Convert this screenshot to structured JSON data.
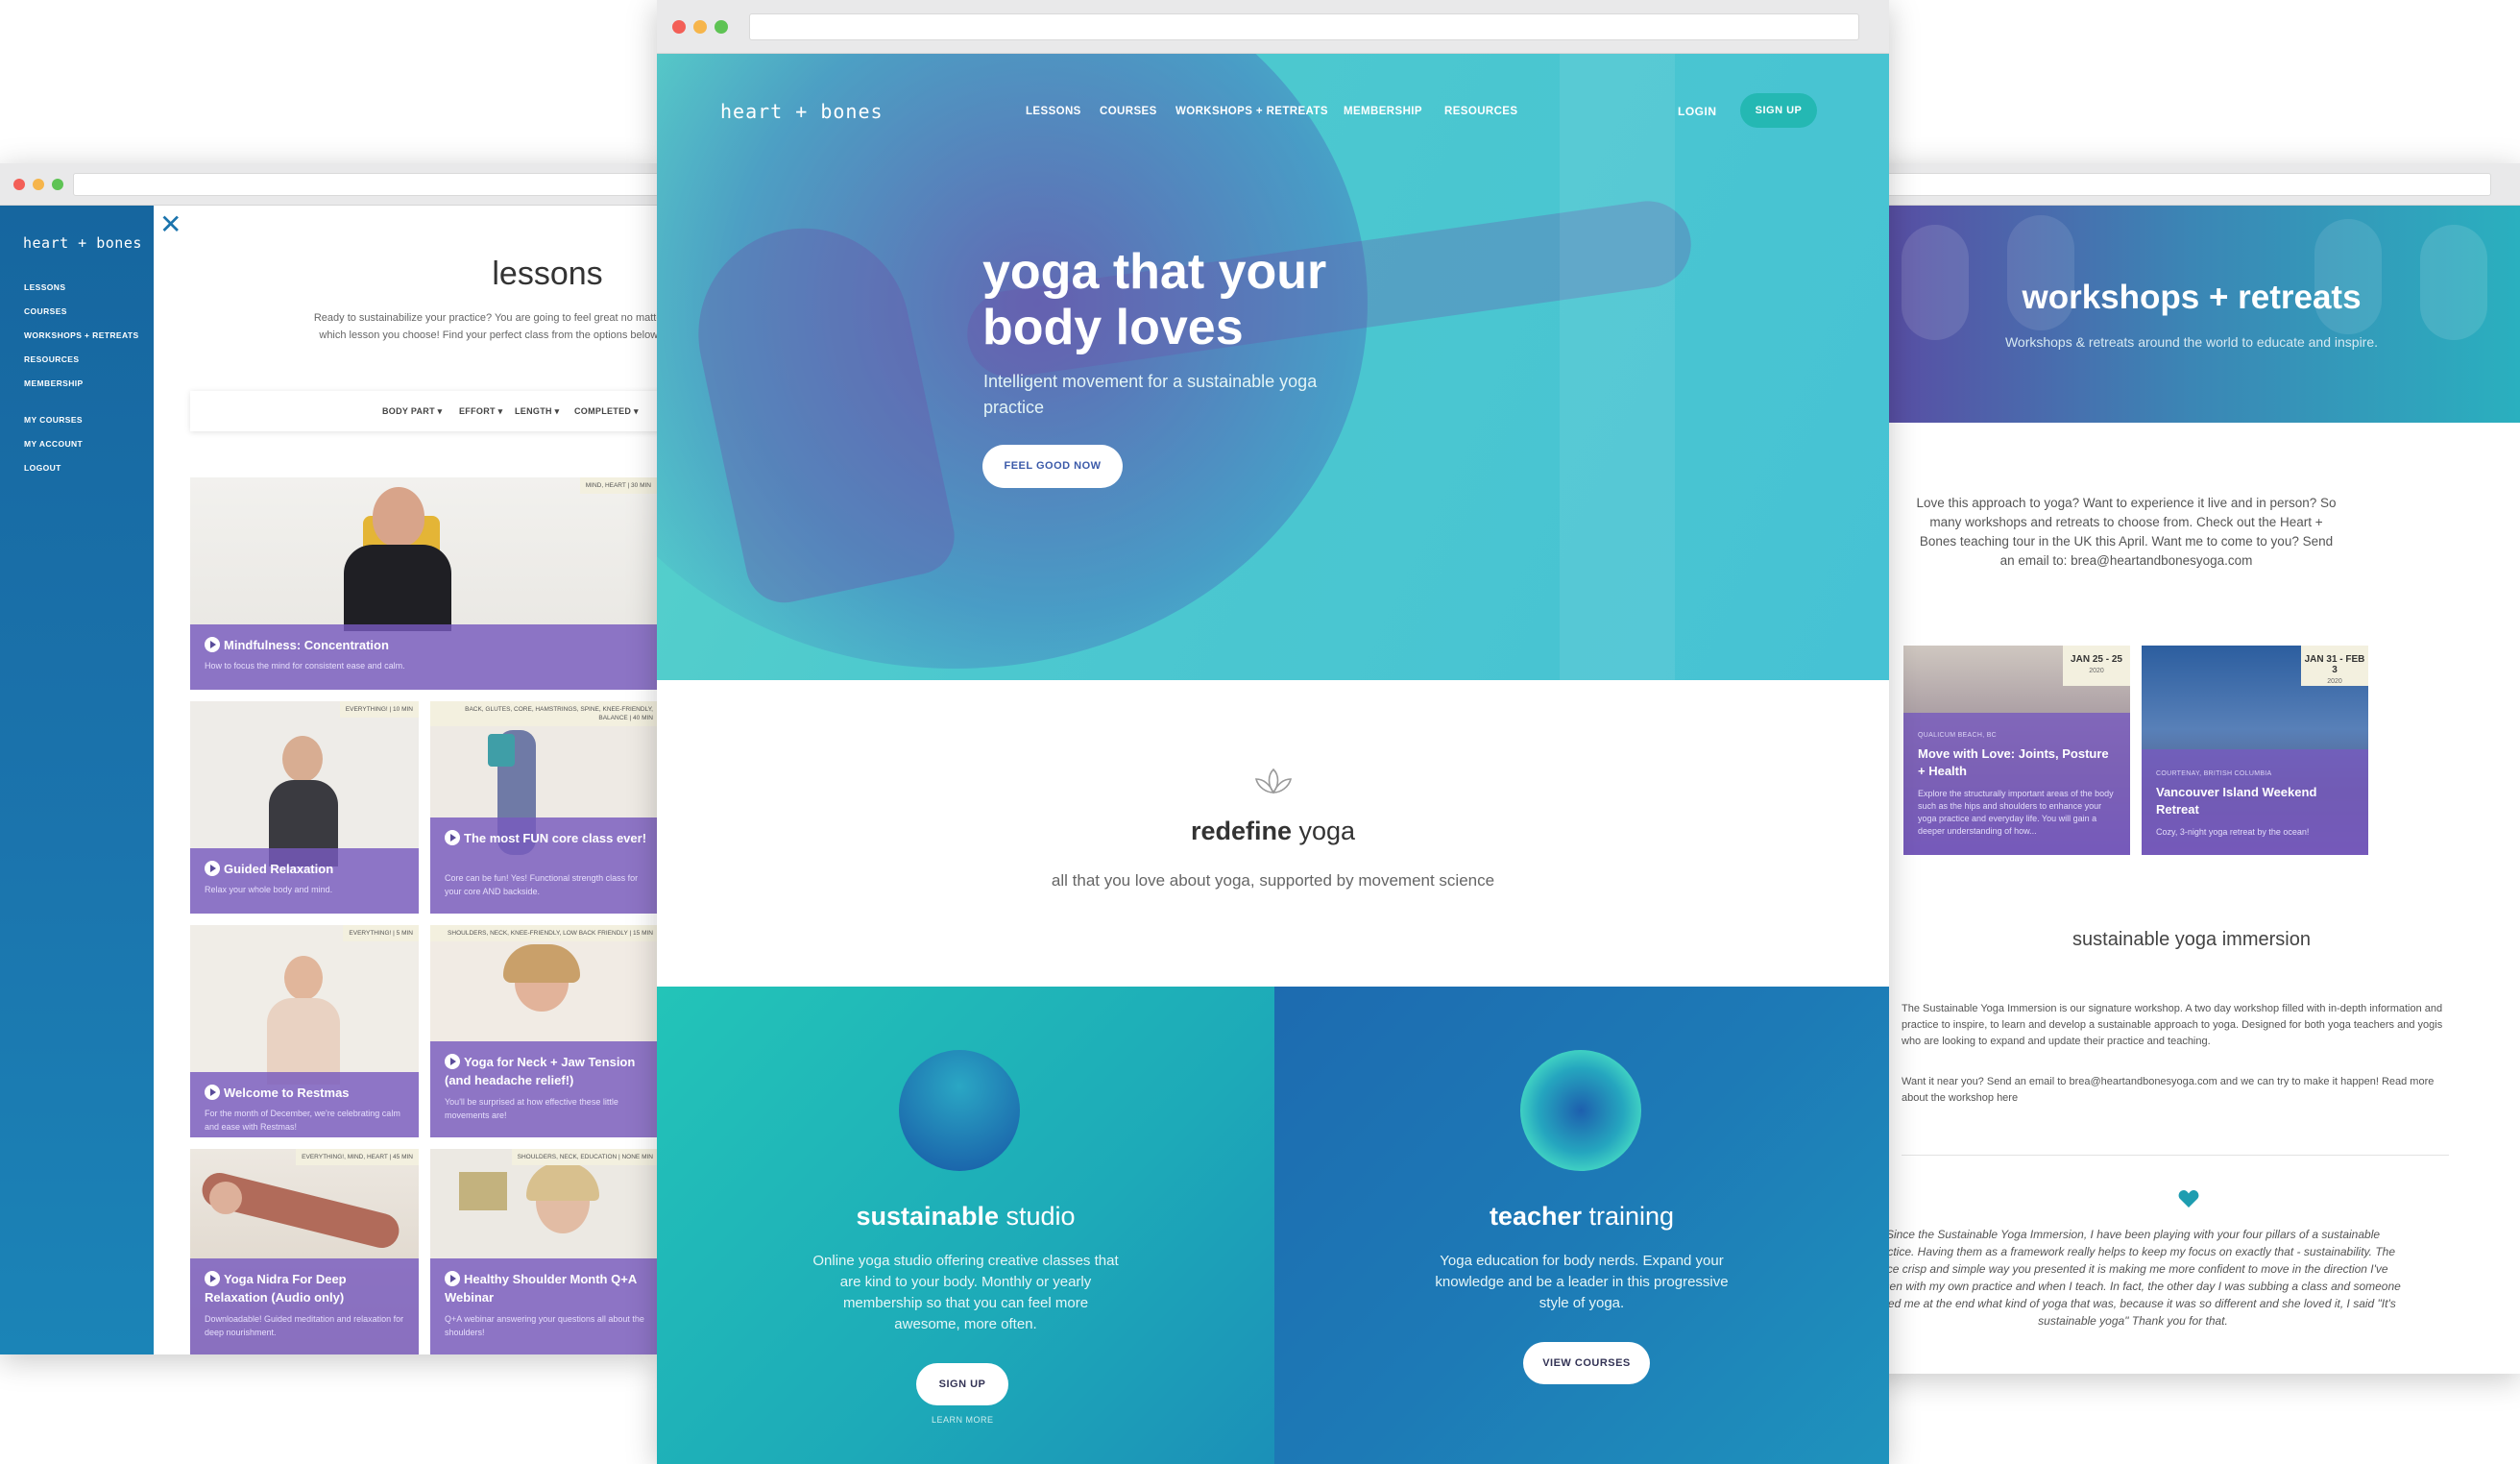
{
  "left_window": {
    "sidebar": {
      "logo": "heart + bones",
      "items": [
        "LESSONS",
        "COURSES",
        "WORKSHOPS + RETREATS",
        "RESOURCES",
        "MEMBERSHIP"
      ],
      "account_items": [
        "MY COURSES",
        "MY ACCOUNT",
        "LOGOUT"
      ]
    },
    "close_icon": "close-icon",
    "title": "lessons",
    "intro": "Ready to sustainabilize your practice? You are going to feel great no matter which lesson you choose! Find your perfect class from the options below.",
    "filters": [
      "BODY PART",
      "EFFORT",
      "LENGTH",
      "COMPLETED"
    ],
    "cards": [
      {
        "title": "Mindfulness: Concentration",
        "desc": "How to focus the mind for consistent ease and calm.",
        "tag": "MIND, HEART | 30 MIN"
      },
      {
        "title": "Guided Relaxation",
        "desc": "Relax your whole body and mind.",
        "tag": "EVERYTHING! | 10 MIN"
      },
      {
        "title": "The most FUN core class ever!",
        "desc": "Core can be fun! Yes! Functional strength class for your core AND backside.",
        "tag": "BACK, GLUTES, CORE, HAMSTRINGS, SPINE, KNEE-FRIENDLY, BALANCE | 40 MIN"
      },
      {
        "title": "Welcome to Restmas",
        "desc": "For the month of December, we're celebrating calm and ease with Restmas!",
        "tag": "EVERYTHING! | 5 MIN"
      },
      {
        "title": "Yoga for Neck + Jaw Tension (and headache relief!)",
        "desc": "You'll be surprised at how effective these little movements are!",
        "tag": "SHOULDERS, NECK, KNEE-FRIENDLY, LOW BACK FRIENDLY | 15 MIN"
      },
      {
        "title": "Yoga Nidra For Deep Relaxation (Audio only)",
        "desc": "Downloadable! Guided meditation and relaxation for deep nourishment.",
        "tag": "EVERYTHING!, MIND, HEART | 45 MIN"
      },
      {
        "title": "Healthy Shoulder Month Q+A Webinar",
        "desc": "Q+A webinar answering your questions all about the shoulders!",
        "tag": "SHOULDERS, NECK, EDUCATION | NONE MIN"
      }
    ]
  },
  "center_window": {
    "logo": "heart + bones",
    "nav": [
      "LESSONS",
      "COURSES",
      "WORKSHOPS + RETREATS",
      "MEMBERSHIP",
      "RESOURCES"
    ],
    "login": "LOGIN",
    "signup": "SIGN UP",
    "hero": {
      "title": "yoga that your body loves",
      "subtitle": "Intelligent movement for a sustainable yoga practice",
      "button": "FEEL GOOD NOW"
    },
    "redefine": {
      "strong": "redefine",
      "rest": " yoga",
      "subtitle": "all that you love about yoga, supported by movement science"
    },
    "panels": [
      {
        "strong": "sustainable",
        "rest": " studio",
        "desc": "Online yoga studio offering creative classes that are kind to your body. Monthly or yearly membership so that you can feel more awesome, more often.",
        "button": "SIGN UP",
        "link": "LEARN MORE"
      },
      {
        "strong": "teacher",
        "rest": " training",
        "desc": "Yoga education for body nerds. Expand your knowledge and be a leader in this progressive style of yoga.",
        "button": "VIEW COURSES"
      }
    ]
  },
  "right_window": {
    "title": "workshops + retreats",
    "subtitle": "Workshops & retreats around the world to educate and inspire.",
    "intro": "Love this approach to yoga? Want to experience it live and in person? So many workshops and retreats to choose from. Check out the Heart + Bones teaching tour in the UK this April. Want me to come to you? Send an email to: brea@heartandbonesyoga.com",
    "events": [
      {
        "date": "JAN 25 - 25",
        "year": "2020",
        "location": "QUALICUM BEACH, BC",
        "name": "Move with Love: Joints, Posture + Health",
        "desc": "Explore the structurally important areas of the body such as the hips and shoulders to enhance your yoga practice and everyday life. You will gain a deeper understanding of how..."
      },
      {
        "date": "JAN 31 - FEB 3",
        "year": "2020",
        "location": "COURTENAY, BRITISH COLUMBIA",
        "name": "Vancouver Island Weekend Retreat",
        "desc": "Cozy, 3-night yoga retreat by the ocean!"
      }
    ],
    "immersion_title": "sustainable yoga immersion",
    "immersion_p1": "The Sustainable Yoga Immersion is our signature workshop. A two day workshop filled with in-depth information and practice to inspire, to learn and develop a sustainable approach to yoga. Designed for both yoga teachers and yogis who are looking to expand and update their practice and teaching.",
    "immersion_p2": "Want it near you? Send an email to brea@heartandbonesyoga.com and we can try to make it happen!  Read more about the workshop here",
    "quote": "Since the Sustainable Yoga Immersion, I have been playing with your four pillars of a sustainable practice. Having them as a framework really helps to keep my focus on exactly that - sustainability. The nice crisp and simple way you presented it is making me more confident to move in the direction I've chosen with my own practice and when I teach. In fact, the other day I was subbing a class and someone asked me at the end what kind of yoga that was, because it was so different and she loved it, I said \"It's sustainable yoga\" Thank you for that."
  },
  "colors": {
    "teal": "#4cc8cf",
    "blue": "#1b74ad",
    "purple": "#7a5ac0",
    "white": "#ffffff"
  }
}
